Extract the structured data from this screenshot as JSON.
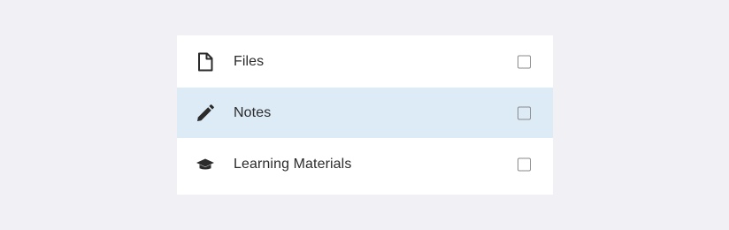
{
  "items": [
    {
      "label": "Files",
      "icon": "file-icon",
      "checked": false,
      "highlighted": false
    },
    {
      "label": "Notes",
      "icon": "pencil-icon",
      "checked": false,
      "highlighted": true
    },
    {
      "label": "Learning Materials",
      "icon": "graduation-cap-icon",
      "checked": false,
      "highlighted": false
    }
  ],
  "colors": {
    "page_background": "#f1f0f5",
    "list_background": "#ffffff",
    "highlight_background": "#ddebf7",
    "text": "#2b2b2b",
    "icon": "#2b2b2b",
    "checkbox_border": "#8a8a8a"
  }
}
